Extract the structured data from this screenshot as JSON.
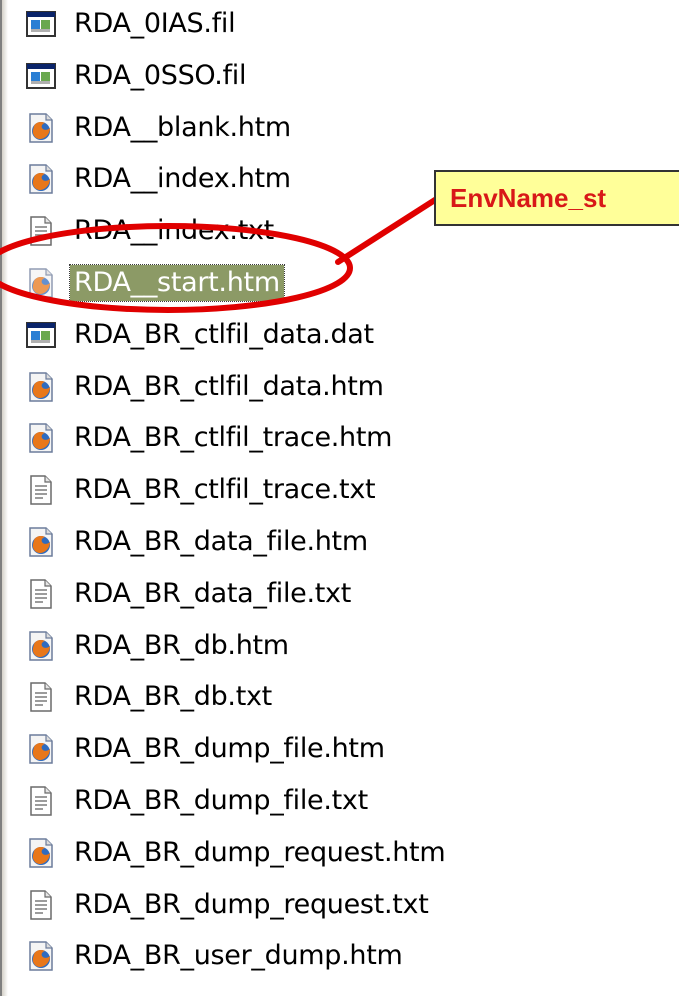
{
  "files": [
    {
      "name": "RDA_0IAS.fil",
      "icon": "fil-file-icon"
    },
    {
      "name": "RDA_0SSO.fil",
      "icon": "fil-file-icon"
    },
    {
      "name": "RDA__blank.htm",
      "icon": "firefox-htm-icon"
    },
    {
      "name": "RDA__index.htm",
      "icon": "firefox-htm-icon"
    },
    {
      "name": "RDA__index.txt",
      "icon": "text-file-icon"
    },
    {
      "name": "RDA__start.htm",
      "icon": "firefox-htm-icon",
      "selected": true
    },
    {
      "name": "RDA_BR_ctlfil_data.dat",
      "icon": "fil-file-icon"
    },
    {
      "name": "RDA_BR_ctlfil_data.htm",
      "icon": "firefox-htm-icon"
    },
    {
      "name": "RDA_BR_ctlfil_trace.htm",
      "icon": "firefox-htm-icon"
    },
    {
      "name": "RDA_BR_ctlfil_trace.txt",
      "icon": "text-file-icon"
    },
    {
      "name": "RDA_BR_data_file.htm",
      "icon": "firefox-htm-icon"
    },
    {
      "name": "RDA_BR_data_file.txt",
      "icon": "text-file-icon"
    },
    {
      "name": "RDA_BR_db.htm",
      "icon": "firefox-htm-icon"
    },
    {
      "name": "RDA_BR_db.txt",
      "icon": "text-file-icon"
    },
    {
      "name": "RDA_BR_dump_file.htm",
      "icon": "firefox-htm-icon"
    },
    {
      "name": "RDA_BR_dump_file.txt",
      "icon": "text-file-icon"
    },
    {
      "name": "RDA_BR_dump_request.htm",
      "icon": "firefox-htm-icon"
    },
    {
      "name": "RDA_BR_dump_request.txt",
      "icon": "text-file-icon"
    },
    {
      "name": "RDA_BR_user_dump.htm",
      "icon": "firefox-htm-icon"
    }
  ],
  "callout": {
    "text": "EnvName_st",
    "text_color": "#d81818",
    "fill_color": "#ffff99",
    "annotation_color": "#e00000"
  },
  "colors": {
    "selection_bg": "#8c9a66",
    "selection_text": "#ffffff"
  }
}
